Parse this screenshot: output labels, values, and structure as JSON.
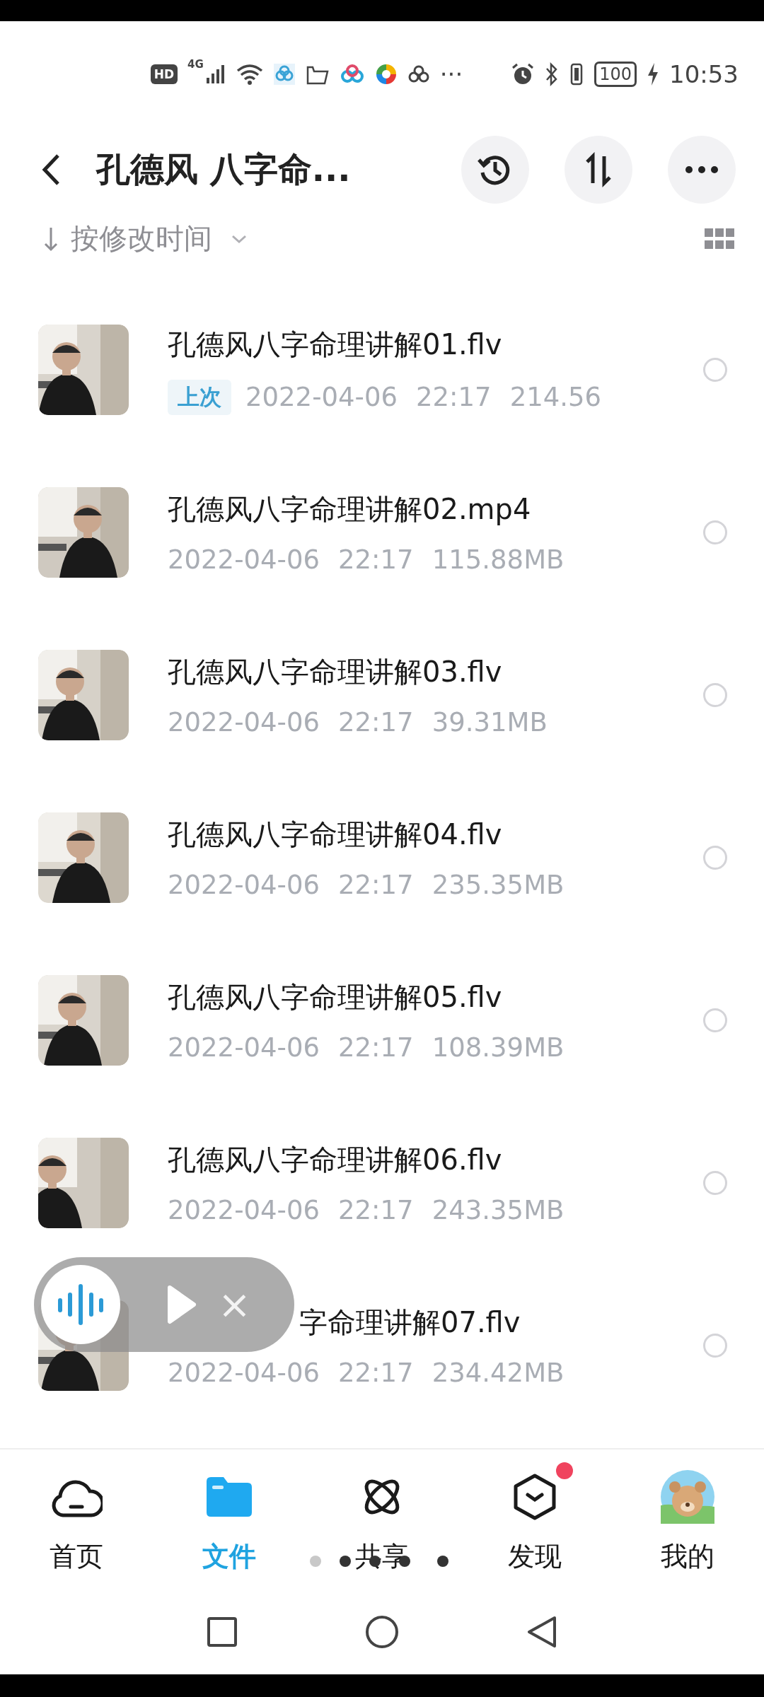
{
  "status_bar": {
    "hd": "HD",
    "network": "4G",
    "more": "···",
    "battery": "100",
    "time": "10:53"
  },
  "header": {
    "title": "孔德风 八字命..."
  },
  "sort": {
    "label": "按修改时间"
  },
  "files": [
    {
      "kind": "file",
      "name": "孔德风八字命理讲解01.flv",
      "tag": "上次",
      "date": "2022-04-06",
      "time": "22:17",
      "size": "214.56",
      "selected": false
    },
    {
      "kind": "file",
      "name": "孔德风八字命理讲解02.mp4",
      "date": "2022-04-06",
      "time": "22:17",
      "size": "115.88MB",
      "selected": false
    },
    {
      "kind": "file",
      "name": "孔德风八字命理讲解03.flv",
      "date": "2022-04-06",
      "time": "22:17",
      "size": "39.31MB",
      "selected": false
    },
    {
      "kind": "file",
      "name": "孔德风八字命理讲解04.flv",
      "date": "2022-04-06",
      "time": "22:17",
      "size": "235.35MB",
      "selected": false
    },
    {
      "kind": "file",
      "name": "孔德风八字命理讲解05.flv",
      "date": "2022-04-06",
      "time": "22:17",
      "size": "108.39MB",
      "selected": false
    },
    {
      "kind": "file",
      "name": "孔德风八字命理讲解06.flv",
      "date": "2022-04-06",
      "time": "22:17",
      "size": "243.35MB",
      "selected": false
    },
    {
      "kind": "covered",
      "name": "字命理讲解07.flv",
      "date": "2022-04-06",
      "time": "22:17",
      "size": "234.42MB",
      "selected": false
    }
  ],
  "player": {
    "close": "×"
  },
  "nav": [
    {
      "kind": "home",
      "label": "首页",
      "selected": false,
      "dot": false
    },
    {
      "kind": "files",
      "label": "文件",
      "selected": true,
      "dot": false
    },
    {
      "kind": "share",
      "label": "共享",
      "selected": false,
      "dot": false
    },
    {
      "kind": "discover",
      "label": "发现",
      "selected": false,
      "dot": true
    },
    {
      "kind": "me",
      "label": "我的",
      "selected": false,
      "dot": false
    }
  ]
}
